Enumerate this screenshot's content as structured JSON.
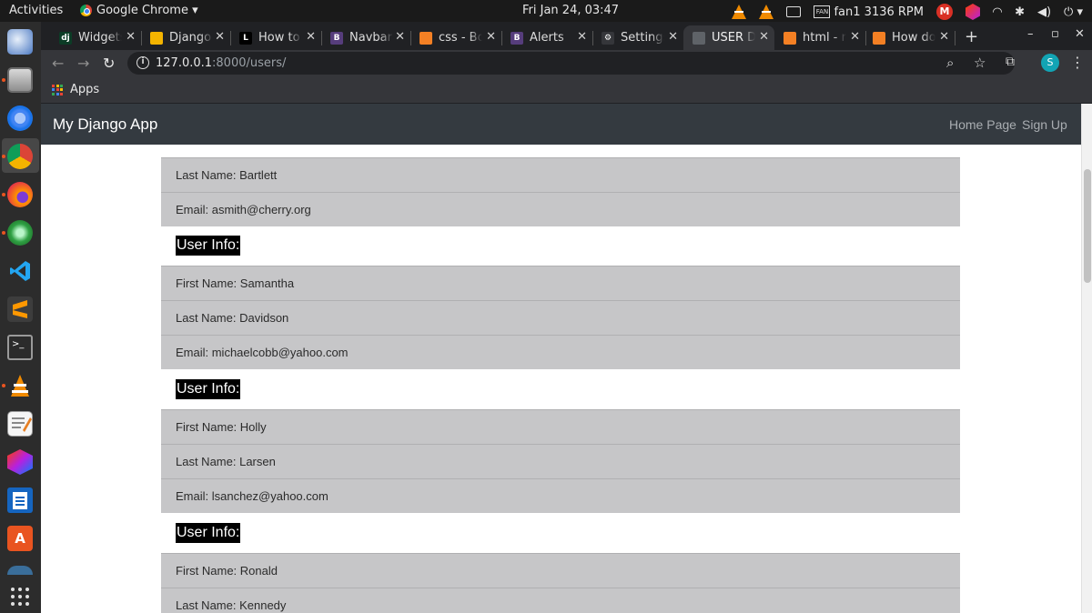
{
  "topbar": {
    "activities": "Activities",
    "app_name": "Google Chrome ▾",
    "clock": "Fri Jan 24, 03:47",
    "fan_chip": "FAN",
    "fan_label": "fan1 3136 RPM",
    "gmail_letter": "M"
  },
  "tabs": [
    {
      "icon_text": "dj",
      "label": "Widgets",
      "icon_color": "#0c3c26"
    },
    {
      "icon_text": "",
      "label": "Django",
      "icon_color": "#f4b400"
    },
    {
      "icon_text": "L",
      "label": "How to",
      "icon_color": "#000000"
    },
    {
      "icon_text": "B",
      "label": "Navbar",
      "icon_color": "#563d7c"
    },
    {
      "icon_text": "",
      "label": "css - Bo",
      "icon_color": "#f48024"
    },
    {
      "icon_text": "B",
      "label": "Alerts",
      "icon_color": "#563d7c"
    },
    {
      "icon_text": "⚙",
      "label": "Settings",
      "icon_color": "#35363a"
    },
    {
      "icon_text": "",
      "label": "USER D",
      "icon_color": "#5f6368"
    },
    {
      "icon_text": "",
      "label": "html - r",
      "icon_color": "#f48024"
    },
    {
      "icon_text": "",
      "label": "How do",
      "icon_color": "#f48024"
    }
  ],
  "toolbar": {
    "url_host": "127.0.0.1",
    "url_rest": ":8000/users/",
    "profile_initial": "S"
  },
  "bookmarks": {
    "apps_label": "Apps"
  },
  "site": {
    "brand": "My Django App",
    "nav": [
      "Home Page",
      "Sign Up"
    ]
  },
  "users": {
    "partial_top": {
      "last_name": "Last Name: Bartlett",
      "email": "Email: asmith@cherry.org"
    },
    "heading_label": "User Info:",
    "entries": [
      {
        "first_name": "First Name: Samantha",
        "last_name": "Last Name: Davidson",
        "email": "Email: michaelcobb@yahoo.com"
      },
      {
        "first_name": "First Name: Holly",
        "last_name": "Last Name: Larsen",
        "email": "Email: lsanchez@yahoo.com"
      },
      {
        "first_name": "First Name: Ronald",
        "last_name": "Last Name: Kennedy",
        "email": ""
      }
    ]
  },
  "colors": {
    "navbar_bg": "#343a40",
    "row_bg": "#c6c6c8",
    "heading_bg": "#000000",
    "tabstrip_bg": "#202124",
    "toolbar_bg": "#35363a"
  }
}
